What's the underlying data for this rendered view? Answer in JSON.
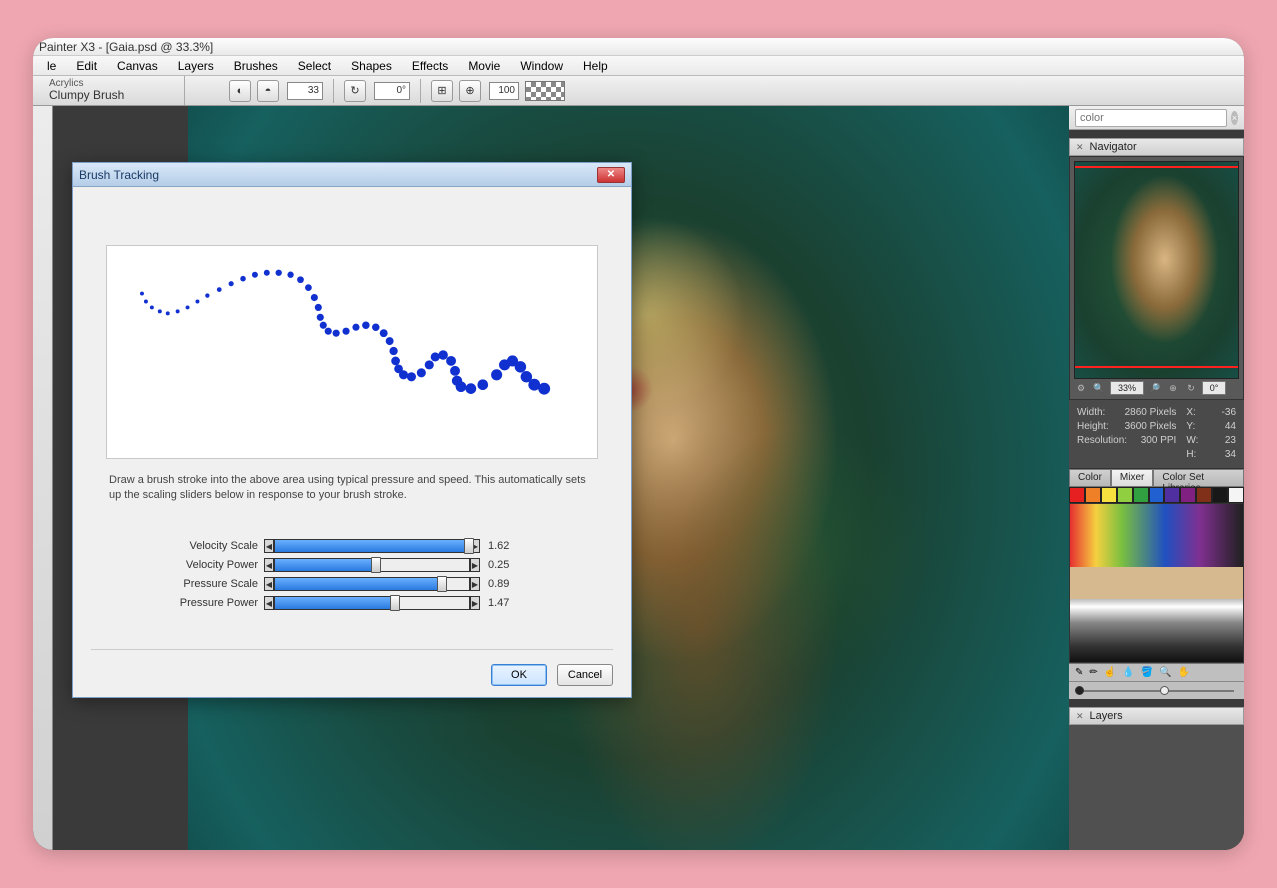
{
  "title_bar": "Painter X3 - [Gaia.psd @ 33.3%]",
  "menu": [
    "le",
    "Edit",
    "Canvas",
    "Layers",
    "Brushes",
    "Select",
    "Shapes",
    "Effects",
    "Movie",
    "Window",
    "Help"
  ],
  "brush": {
    "category": "Acrylics",
    "name": "Clumpy Brush"
  },
  "toolstrip": {
    "size_value": "33",
    "angle_value": "0°",
    "zoom_value": "100"
  },
  "search": {
    "placeholder": "color"
  },
  "navigator": {
    "title": "Navigator",
    "zoom": "33%",
    "angle": "0°"
  },
  "info": {
    "width_label": "Width:",
    "width_val": "2860 Pixels",
    "height_label": "Height:",
    "height_val": "3600 Pixels",
    "res_label": "Resolution:",
    "res_val": "300 PPI",
    "x_label": "X:",
    "x_val": "-36",
    "y_label": "Y:",
    "y_val": "44",
    "w_label": "W:",
    "w_val": "23",
    "h_label": "H:",
    "h_val": "34"
  },
  "color_tabs": {
    "color": "Color",
    "mixer": "Mixer",
    "libs": "Color Set Libraries"
  },
  "swatches": [
    "#e62020",
    "#f08028",
    "#f6e040",
    "#90d040",
    "#30a040",
    "#2060d0",
    "#5030a0",
    "#802080",
    "#803018",
    "#181818",
    "#f4f4f4"
  ],
  "layers_title": "Layers",
  "dialog": {
    "title": "Brush Tracking",
    "instruction": "Draw a brush stroke into the above area using typical pressure and speed.  This automatically sets up the scaling sliders below in response to your brush stroke.",
    "sliders": [
      {
        "label": "Velocity Scale",
        "value": "1.62",
        "fill": 100
      },
      {
        "label": "Velocity Power",
        "value": "0.25",
        "fill": 52
      },
      {
        "label": "Pressure Scale",
        "value": "0.89",
        "fill": 86
      },
      {
        "label": "Pressure Power",
        "value": "1.47",
        "fill": 62
      }
    ],
    "ok": "OK",
    "cancel": "Cancel"
  }
}
